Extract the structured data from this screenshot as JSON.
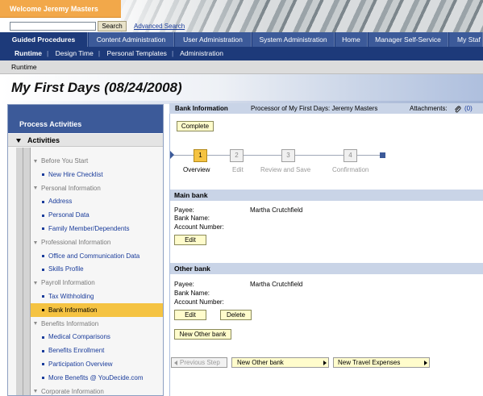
{
  "header": {
    "welcome": "Welcome Jeremy Masters",
    "search_label": "Search",
    "advanced_search": "Advanced Search"
  },
  "topnav": [
    "Guided Procedures",
    "Content Administration",
    "User Administration",
    "System Administration",
    "Home",
    "Manager Self-Service",
    "My Staf"
  ],
  "subnav": [
    "Runtime",
    "Design Time",
    "Personal Templates",
    "Administration"
  ],
  "breadcrumb": "Runtime",
  "page_title": "My First Days (08/24/2008)",
  "left": {
    "panel_title": "Process Activities",
    "activities_title": "Activities",
    "items": [
      {
        "type": "group",
        "label": "Before You Start"
      },
      {
        "type": "item",
        "label": "New Hire Checklist"
      },
      {
        "type": "group",
        "label": "Personal Information"
      },
      {
        "type": "item",
        "label": "Address"
      },
      {
        "type": "item",
        "label": "Personal Data"
      },
      {
        "type": "item",
        "label": "Family Member/Dependents"
      },
      {
        "type": "group",
        "label": "Professional Information"
      },
      {
        "type": "item",
        "label": "Office and Communication Data"
      },
      {
        "type": "item",
        "label": "Skills Profile"
      },
      {
        "type": "group",
        "label": "Payroll Information"
      },
      {
        "type": "item",
        "label": "Tax Withholding"
      },
      {
        "type": "item",
        "label": "Bank Information",
        "selected": true
      },
      {
        "type": "group",
        "label": "Benefits Information"
      },
      {
        "type": "item",
        "label": "Medical Comparisons"
      },
      {
        "type": "item",
        "label": "Benefits Enrollment"
      },
      {
        "type": "item",
        "label": "Participation Overview"
      },
      {
        "type": "item",
        "label": "More Benefits @ YouDecide.com"
      },
      {
        "type": "group",
        "label": "Corporate Information"
      }
    ]
  },
  "right": {
    "bar_title": "Bank Information",
    "processor": "Processor of My First Days: Jeremy Masters",
    "attachments_label": "Attachments:",
    "attachments_count": "(0)",
    "complete_label": "Complete",
    "steps": [
      {
        "num": "1",
        "label": "Overview",
        "selected": true
      },
      {
        "num": "2",
        "label": "Edit"
      },
      {
        "num": "3",
        "label": "Review and Save"
      },
      {
        "num": "4",
        "label": "Confirmation"
      }
    ],
    "main_bank": {
      "title": "Main bank",
      "payee_label": "Payee:",
      "payee_value": "Martha Crutchfield",
      "bank_name_label": "Bank Name:",
      "account_label": "Account Number:",
      "edit_label": "Edit"
    },
    "other_bank": {
      "title": "Other bank",
      "payee_label": "Payee:",
      "payee_value": "Martha Crutchfield",
      "bank_name_label": "Bank Name:",
      "account_label": "Account Number:",
      "edit_label": "Edit",
      "delete_label": "Delete"
    },
    "new_other_bank": "New Other bank",
    "nav": {
      "previous": "Previous Step",
      "next1": "New Other bank",
      "next2": "New Travel Expenses"
    }
  },
  "colors": {
    "welcome_orange": "#f2a84a",
    "nav_blue": "#1d3a7a",
    "selected_yellow": "#f5c342",
    "section_blue": "#c9d4e7"
  }
}
